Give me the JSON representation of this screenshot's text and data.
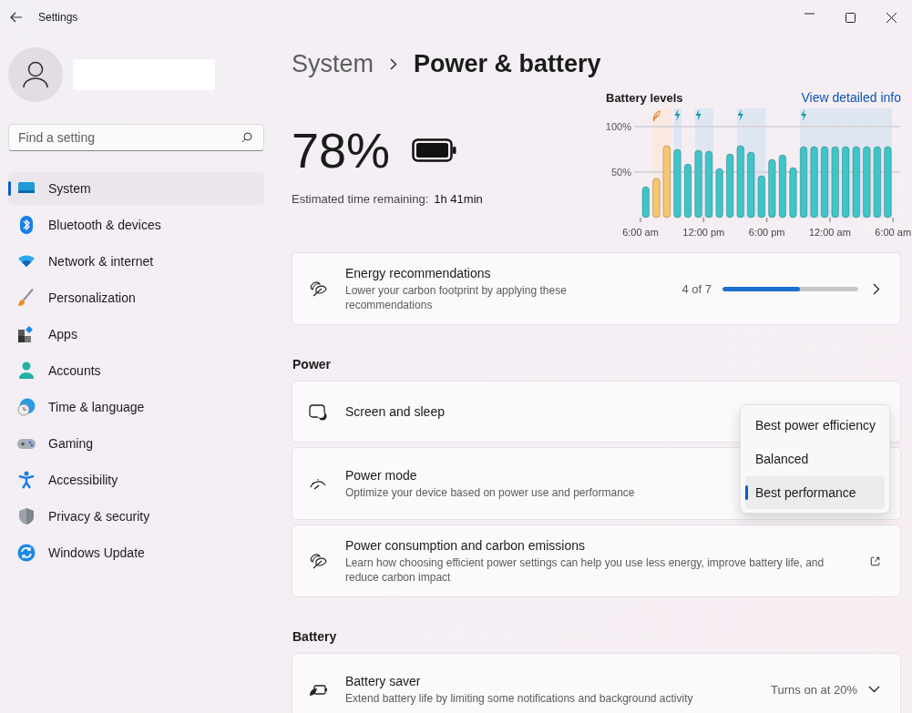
{
  "window": {
    "title": "Settings"
  },
  "sidebar": {
    "search": {
      "placeholder": "Find a setting"
    },
    "items": [
      {
        "label": "System",
        "selected": true
      },
      {
        "label": "Bluetooth & devices",
        "selected": false
      },
      {
        "label": "Network & internet",
        "selected": false
      },
      {
        "label": "Personalization",
        "selected": false
      },
      {
        "label": "Apps",
        "selected": false
      },
      {
        "label": "Accounts",
        "selected": false
      },
      {
        "label": "Time & language",
        "selected": false
      },
      {
        "label": "Gaming",
        "selected": false
      },
      {
        "label": "Accessibility",
        "selected": false
      },
      {
        "label": "Privacy & security",
        "selected": false
      },
      {
        "label": "Windows Update",
        "selected": false
      }
    ]
  },
  "breadcrumb": [
    "System",
    "Power & battery"
  ],
  "battery": {
    "percent": "78%",
    "estimate_label": "Estimated time remaining:",
    "estimate_value": "1h 41min"
  },
  "battery_levels": {
    "title": "Battery levels",
    "link": "View detailed info",
    "charging": [
      false,
      false,
      false,
      true,
      false,
      true,
      true,
      false,
      false,
      true,
      true,
      true,
      false,
      false,
      false,
      true,
      true,
      true,
      true,
      true,
      true,
      true,
      true,
      true
    ],
    "axis_end_label": "6:00 am",
    "chart_data": {
      "type": "bar",
      "categories": [
        "6:00 am",
        null,
        null,
        null,
        null,
        null,
        "12:00 pm",
        null,
        null,
        null,
        null,
        null,
        "6:00 pm",
        null,
        null,
        null,
        null,
        null,
        "12:00 am",
        null,
        null,
        null,
        null,
        null
      ],
      "ylim": [
        0,
        100
      ],
      "yticks": [
        {
          "value": 50,
          "label": "50%"
        },
        {
          "value": 100,
          "label": "100%"
        }
      ],
      "series": [
        {
          "color": "#3ec5c8",
          "values": [
            34,
            null,
            null,
            75,
            59,
            74,
            73,
            54,
            70,
            79,
            72,
            46,
            64,
            69,
            55,
            78,
            78,
            78,
            78,
            78,
            78,
            78,
            78,
            78
          ]
        },
        {
          "color": "#f8c66c",
          "values": [
            null,
            43,
            79,
            null,
            null,
            null,
            null,
            null,
            null,
            null,
            null,
            null,
            null,
            null,
            null,
            null,
            null,
            null,
            null,
            null,
            null,
            null,
            null,
            null
          ]
        }
      ]
    }
  },
  "recommendations": {
    "title": "Energy recommendations",
    "description": "Lower your carbon footprint by applying these recommendations",
    "progress_text": "4 of 7",
    "level": 0.57
  },
  "sections": [
    {
      "heading": "Power",
      "cards": [
        {
          "kind": "under_menu",
          "title": "Screen and sleep"
        },
        {
          "kind": "under_menu",
          "title": "Power mode",
          "description": "Optimize your device based on power use and performance"
        },
        {
          "kind": "external",
          "title": "Power consumption and carbon emissions",
          "description": "Learn how choosing efficient power settings can help you use less energy, improve battery life, and reduce carbon impact"
        }
      ]
    },
    {
      "heading": "Battery",
      "cards": [
        {
          "kind": "expand",
          "title": "Battery saver",
          "description": "Extend battery life by limiting some notifications and background activity",
          "value": "Turns on at 20%"
        }
      ]
    }
  ],
  "power_mode_menu": {
    "options": [
      {
        "label": "Best power efficiency",
        "selected": false
      },
      {
        "label": "Balanced",
        "selected": false
      },
      {
        "label": "Best performance",
        "selected": true
      }
    ]
  }
}
